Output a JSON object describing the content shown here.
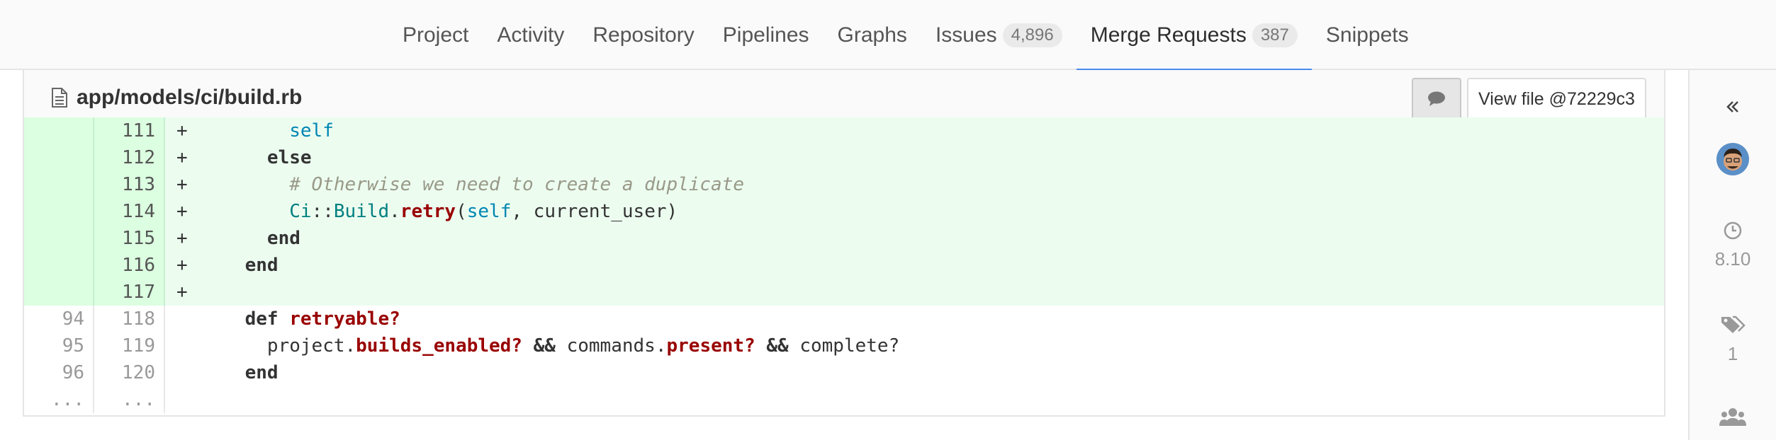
{
  "nav": {
    "tabs": [
      {
        "label": "Project"
      },
      {
        "label": "Activity"
      },
      {
        "label": "Repository"
      },
      {
        "label": "Pipelines"
      },
      {
        "label": "Graphs"
      },
      {
        "label": "Issues",
        "count": "4,896"
      },
      {
        "label": "Merge Requests",
        "count": "387"
      },
      {
        "label": "Snippets"
      }
    ]
  },
  "file": {
    "path": "app/models/ci/build.rb",
    "view_button_label": "View file @72229c3",
    "lines": [
      {
        "old": "",
        "new": "111",
        "sign": "+",
        "type": "add"
      },
      {
        "old": "",
        "new": "112",
        "sign": "+",
        "type": "add"
      },
      {
        "old": "",
        "new": "113",
        "sign": "+",
        "type": "add"
      },
      {
        "old": "",
        "new": "114",
        "sign": "+",
        "type": "add"
      },
      {
        "old": "",
        "new": "115",
        "sign": "+",
        "type": "add"
      },
      {
        "old": "",
        "new": "116",
        "sign": "+",
        "type": "add"
      },
      {
        "old": "",
        "new": "117",
        "sign": "+",
        "type": "add"
      },
      {
        "old": "94",
        "new": "118",
        "sign": "",
        "type": "context"
      },
      {
        "old": "95",
        "new": "119",
        "sign": "",
        "type": "context"
      },
      {
        "old": "96",
        "new": "120",
        "sign": "",
        "type": "context"
      },
      {
        "old": "...",
        "new": "...",
        "sign": "",
        "type": "context"
      }
    ],
    "tokens": {
      "l111_self": "self",
      "l112_else": "else",
      "l113_comment": "# Otherwise we need to create a duplicate",
      "l114_ci": "Ci",
      "l114_sep": "::",
      "l114_build": "Build",
      "l114_dot": ".",
      "l114_retry": "retry",
      "l114_paren": "(",
      "l114_self": "self",
      "l114_args": ", current_user)",
      "l115_end": "end",
      "l116_end": "end",
      "l118_def": "def",
      "l118_name": "retryable?",
      "l119_project": "project.",
      "l119_builds": "builds_enabled?",
      "l119_and1": "&&",
      "l119_commands": " commands.",
      "l119_present": "present?",
      "l119_and2": "&&",
      "l119_complete": " complete?",
      "l120_end": "end"
    }
  },
  "sidebar": {
    "milestone": "8.10",
    "labels_count": "1"
  }
}
